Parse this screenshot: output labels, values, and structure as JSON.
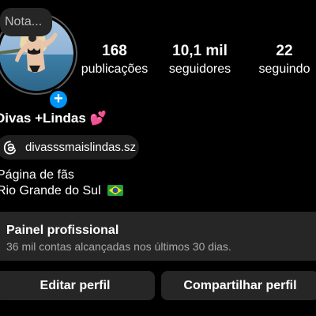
{
  "profile": {
    "note_placeholder": "Nota...",
    "display_name": "Divas +Lindas 💕",
    "threads_handle": "divasssmaislindas.sz",
    "bio_line1": "Página de fãs",
    "bio_line2": "Rio Grande do Sul",
    "add_icon": "+"
  },
  "stats": {
    "posts_count": "168",
    "posts_label": "publicações",
    "followers_count": "10,1 mil",
    "followers_label": "seguidores",
    "following_count": "22",
    "following_label": "seguindo"
  },
  "dashboard": {
    "title": "Painel profissional",
    "subtitle": "36 mil contas alcançadas nos últimos 30 dias."
  },
  "actions": {
    "edit_label": "Editar perfil",
    "share_label": "Compartilhar perfil"
  },
  "colors": {
    "background": "#000000",
    "surface": "#262626",
    "accent": "#0095f6",
    "muted_text": "#a8a8a8"
  },
  "icons": {
    "threads": "threads-icon",
    "flag": "brazil-flag-icon",
    "add": "add-story-icon"
  }
}
